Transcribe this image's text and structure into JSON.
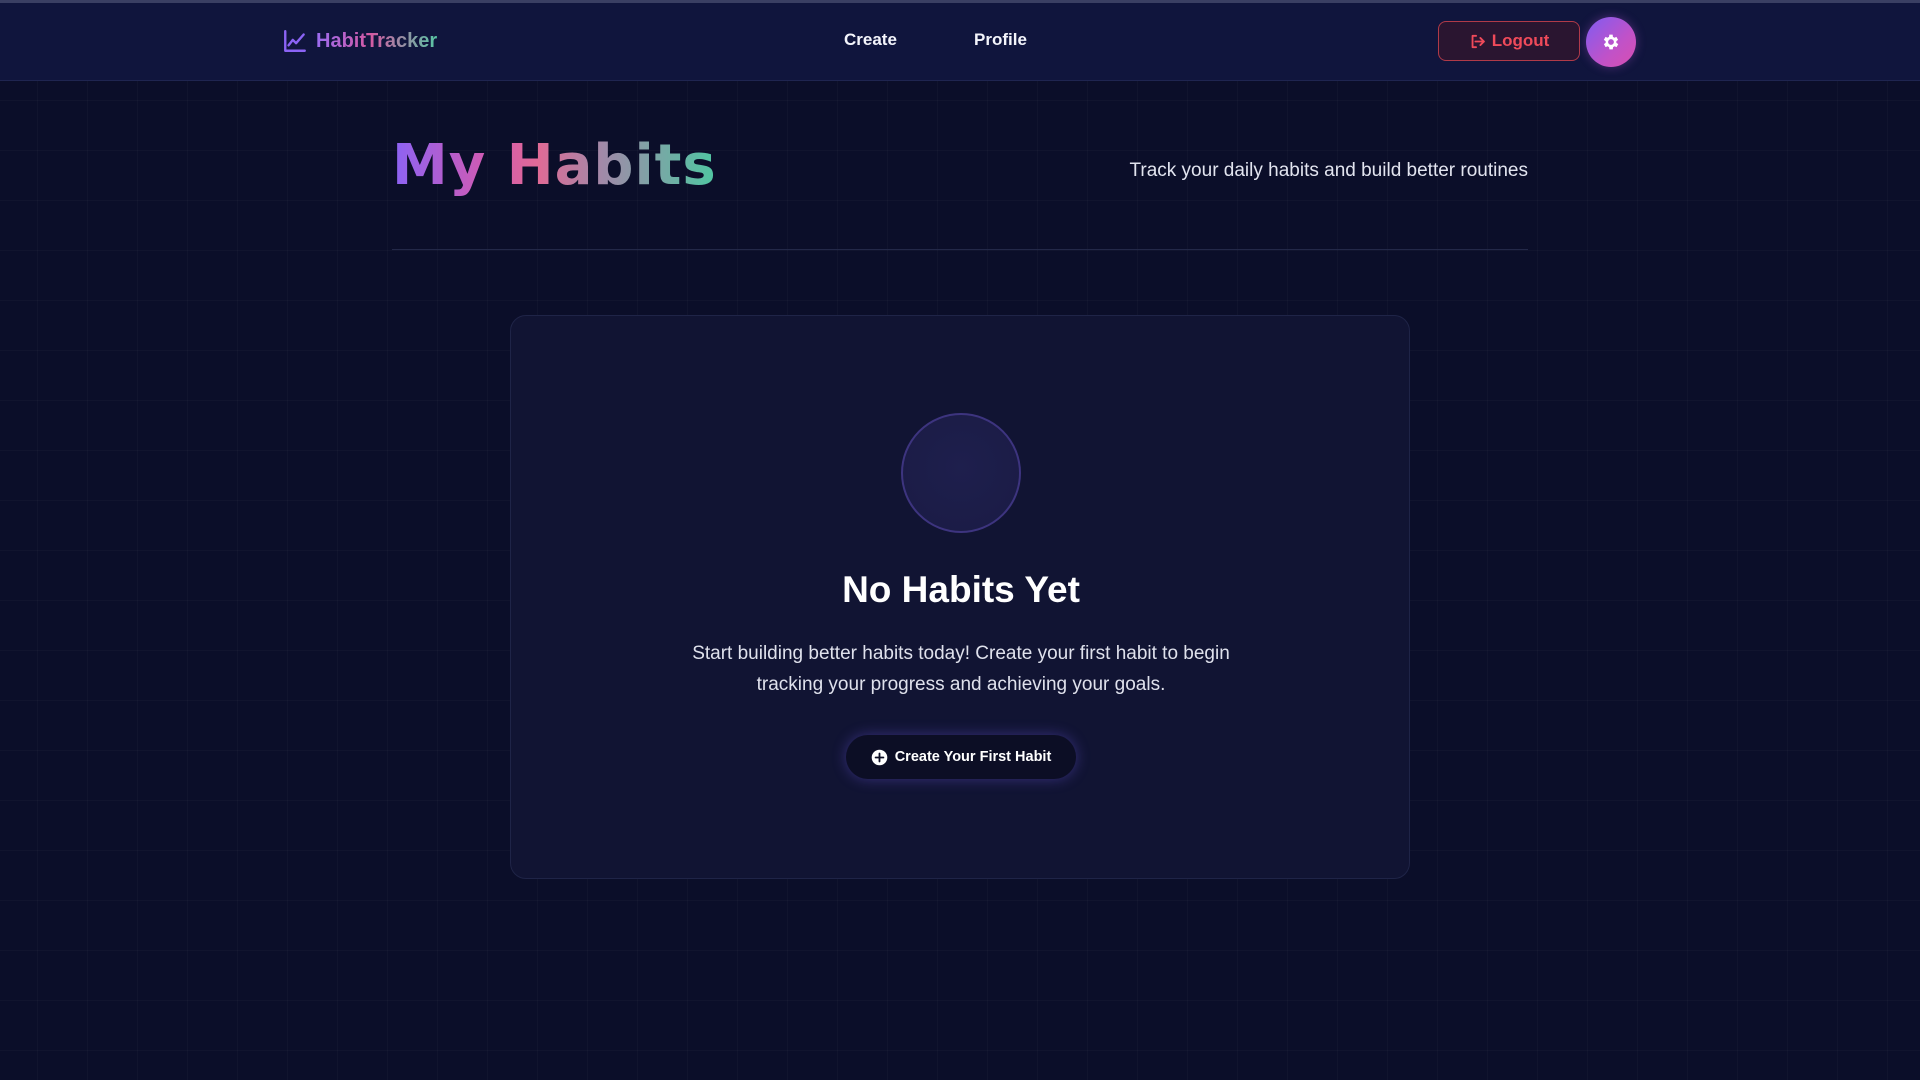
{
  "app": {
    "name": "HabitTracker",
    "brand_icon": "chart-line-icon"
  },
  "nav": {
    "links": [
      {
        "label": "Create"
      },
      {
        "label": "Profile"
      }
    ],
    "logout": {
      "label": "Logout",
      "icon": "sign-out-icon"
    },
    "settings": {
      "icon": "gear-icon"
    }
  },
  "header": {
    "title": "My Habits",
    "subtitle": "Track your daily habits and build better routines"
  },
  "empty_state": {
    "title": "No Habits Yet",
    "description": "Start building better habits today! Create your first habit to begin tracking your progress and achieving your goals.",
    "cta": {
      "label": "Create Your First Habit",
      "icon": "plus-circle-icon"
    }
  },
  "colors": {
    "background": "#0b0e29",
    "navbar": "#10153d",
    "card": "#111433",
    "accent_purple": "#8b63f5",
    "accent_pink": "#d35ab0",
    "accent_green": "#4fc7a2",
    "logout_red": "#ef4a5a"
  }
}
